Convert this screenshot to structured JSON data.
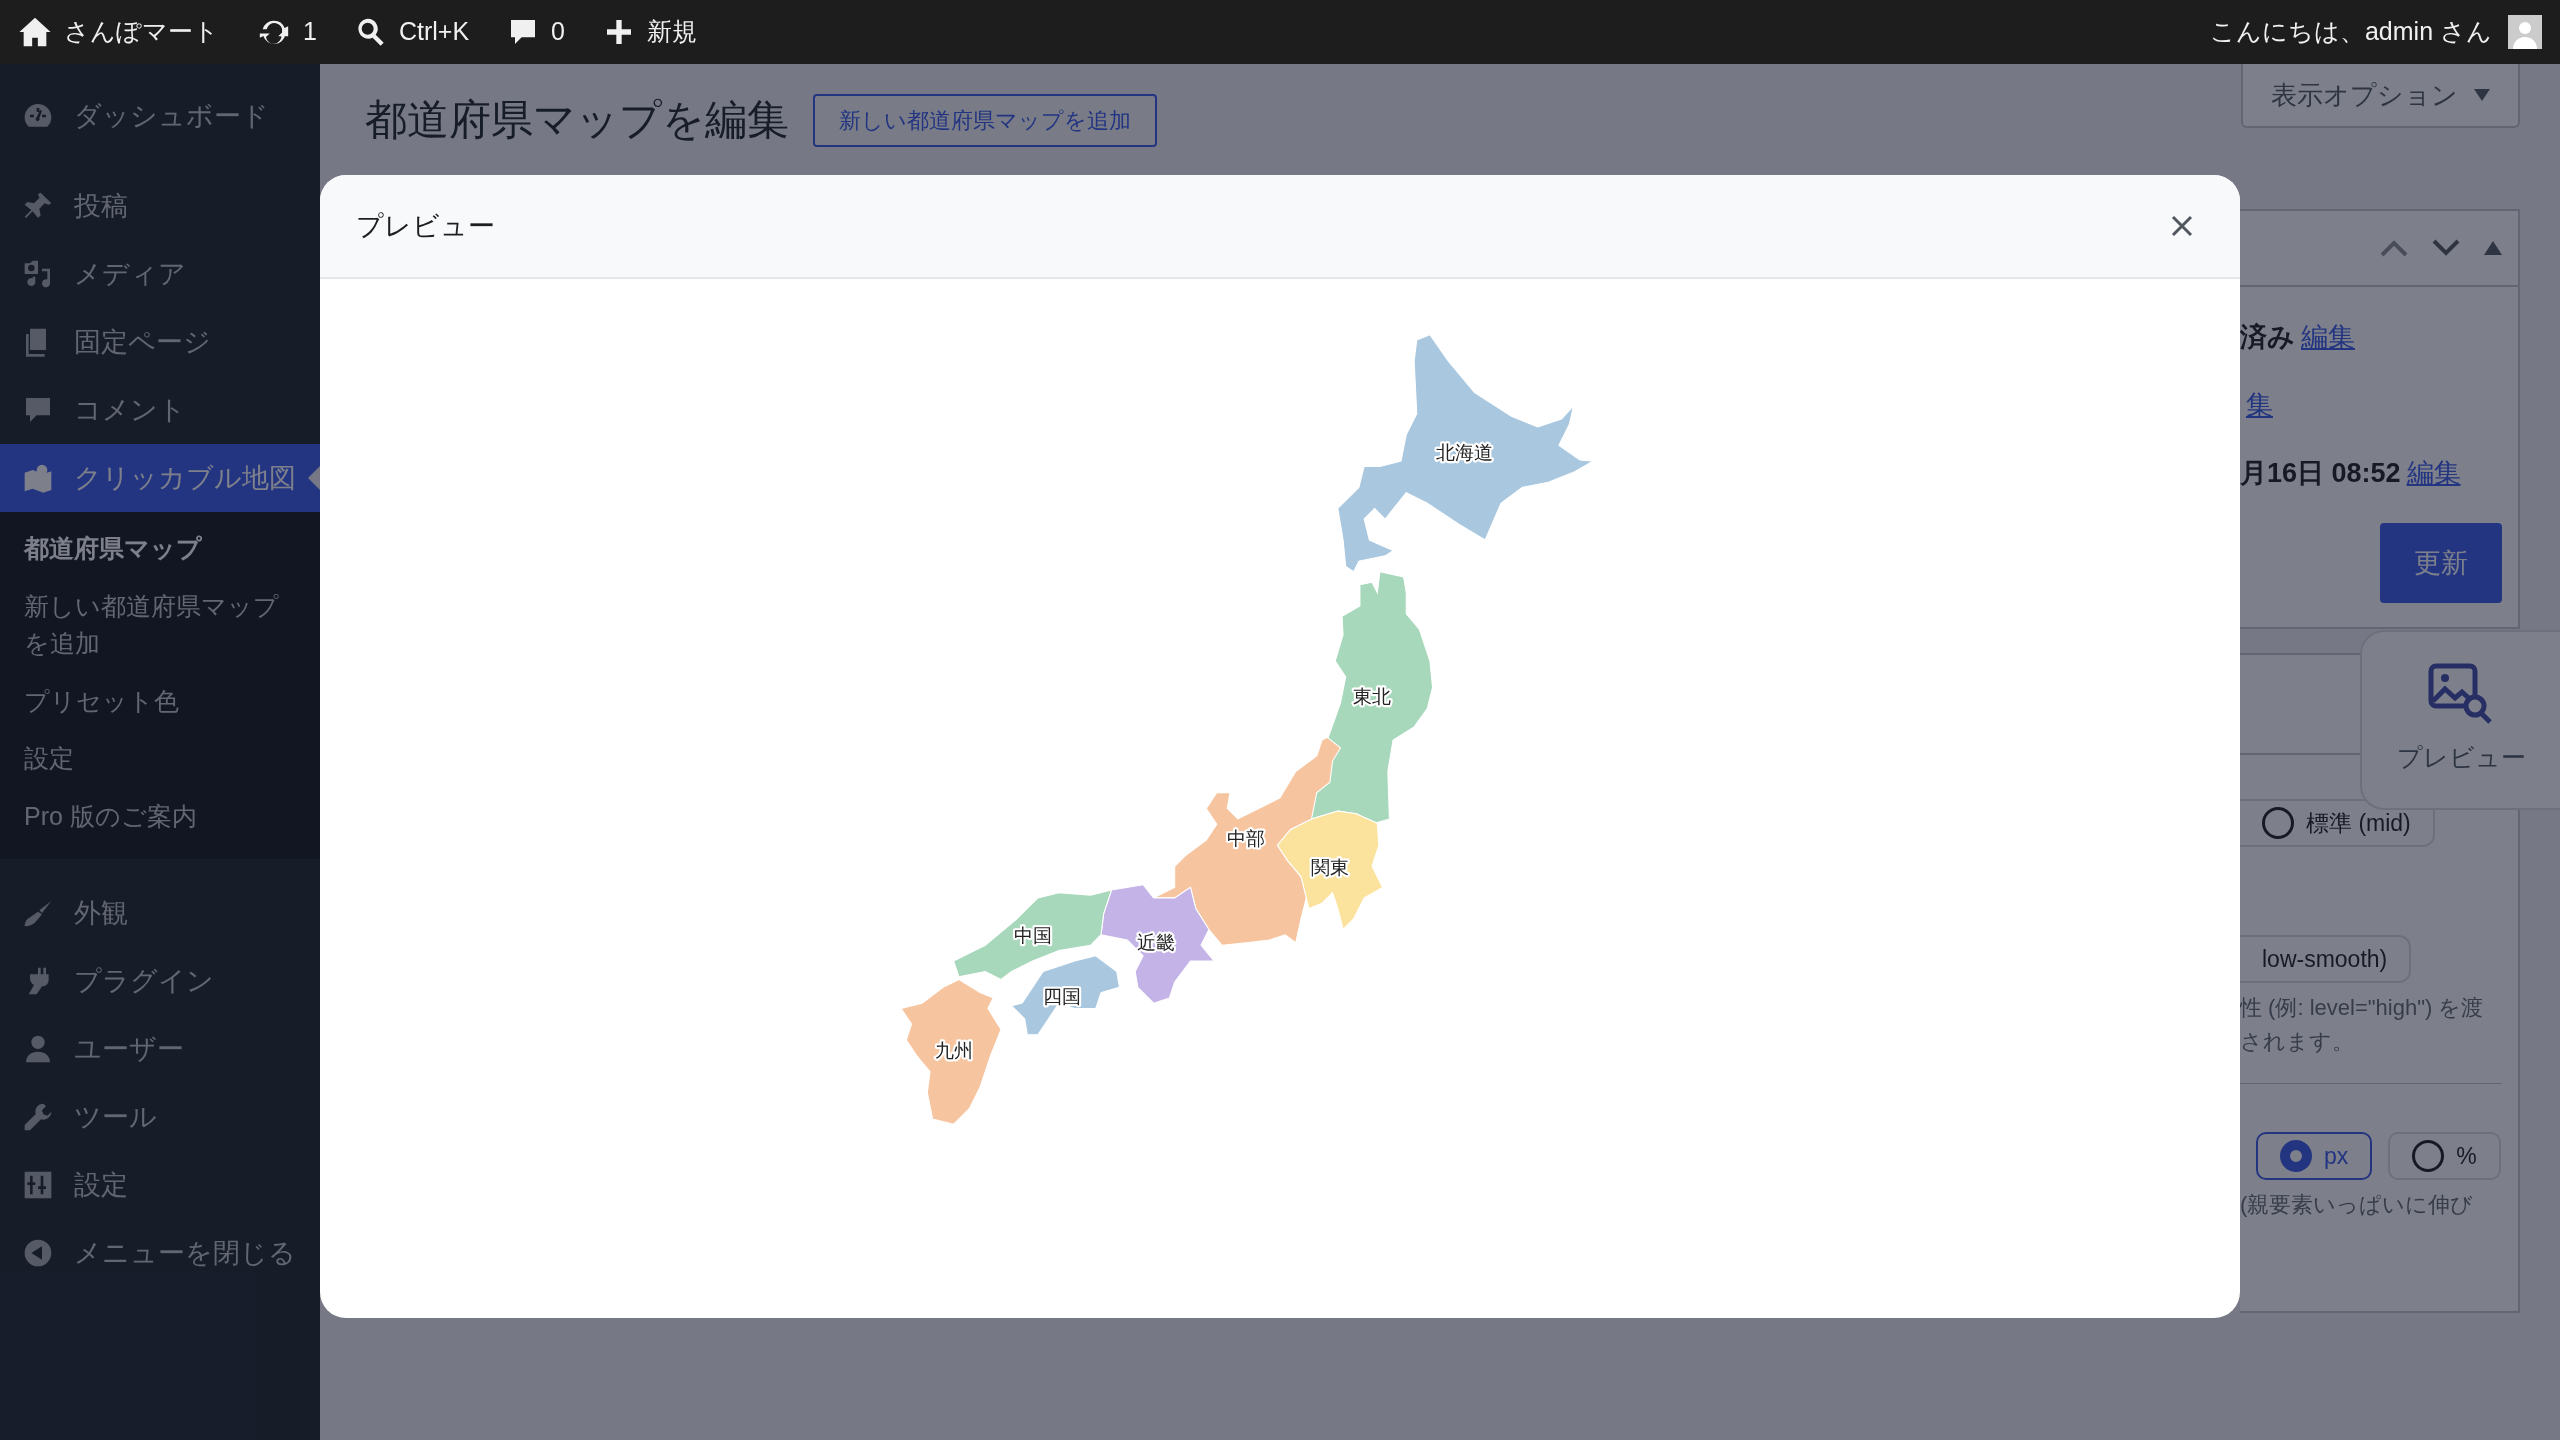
{
  "admin_bar": {
    "site_name": "さんぽマート",
    "updates": "1",
    "search_shortcut": "Ctrl+K",
    "comments": "0",
    "new_label": "新規",
    "greeting": "こんにちは、admin さん"
  },
  "sidebar": {
    "items": [
      {
        "label": "ダッシュボード",
        "selected": false
      },
      {
        "label": "投稿",
        "selected": false
      },
      {
        "label": "メディア",
        "selected": false
      },
      {
        "label": "固定ページ",
        "selected": false
      },
      {
        "label": "コメント",
        "selected": false
      },
      {
        "label": "クリッカブル地図",
        "selected": true,
        "submenu": [
          {
            "label": "都道府県マップ",
            "selected": true
          },
          {
            "label": "新しい都道府県マップを追加",
            "selected": false
          },
          {
            "label": "プリセット色",
            "selected": false
          },
          {
            "label": "設定",
            "selected": false
          },
          {
            "label": "Pro 版のご案内",
            "selected": false
          }
        ]
      },
      {
        "label": "外観",
        "selected": false
      },
      {
        "label": "プラグイン",
        "selected": false
      },
      {
        "label": "ユーザー",
        "selected": false
      },
      {
        "label": "ツール",
        "selected": false
      },
      {
        "label": "設定",
        "selected": false
      },
      {
        "label": "メニューを閉じる",
        "selected": false
      }
    ]
  },
  "page": {
    "title": "都道府県マップを編集",
    "add_new_button": "新しい都道府県マップを追加",
    "screen_options": "表示オプション"
  },
  "publish_box": {
    "lines": [
      {
        "bold": "済み",
        "link": "編集"
      },
      {
        "link": "集"
      },
      {
        "bold": "月16日 08:52",
        "link": "編集"
      }
    ],
    "update_button": "更新"
  },
  "preview_button": {
    "label": "プレビュー"
  },
  "settings": {
    "quality_options": [
      {
        "label": "標準 (mid)",
        "selected": false
      }
    ],
    "smoothing_option": "low-smooth)",
    "help_lines": [
      "性 (例: level=\"high\") を渡",
      "されます。"
    ],
    "unit_options": [
      {
        "label": "px",
        "selected": true
      },
      {
        "label": "%",
        "selected": false
      }
    ],
    "unit_note": "(親要素いっぱいに伸び"
  },
  "modal": {
    "title": "プレビュー",
    "regions": [
      {
        "name": "北海道",
        "color": "#a9c8e0"
      },
      {
        "name": "東北",
        "color": "#a8d8bb"
      },
      {
        "name": "関東",
        "color": "#fbe39d"
      },
      {
        "name": "中部",
        "color": "#f6c49f"
      },
      {
        "name": "近畿",
        "color": "#c3b3e6"
      },
      {
        "name": "中国",
        "color": "#a8d8bb"
      },
      {
        "name": "四国",
        "color": "#a9c8e0"
      },
      {
        "name": "九州",
        "color": "#f6c49f"
      }
    ]
  }
}
